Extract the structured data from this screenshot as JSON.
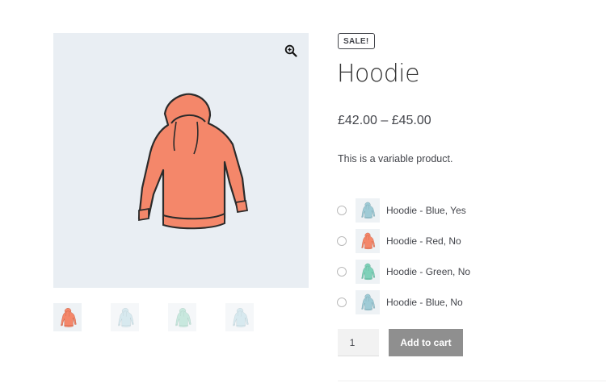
{
  "product": {
    "sale_badge": "SALE!",
    "title": "Hoodie",
    "price": "£42.00 – £45.00",
    "description": "This is a variable product."
  },
  "gallery": {
    "main_color": "#f4876a",
    "thumbs": [
      {
        "color": "#f4876a",
        "faded": false
      },
      {
        "color": "#b8d8e3",
        "faded": true
      },
      {
        "color": "#9cd6c4",
        "faded": true
      },
      {
        "color": "#b8d8e3",
        "faded": true
      }
    ]
  },
  "variations": [
    {
      "label": "Hoodie - Blue, Yes",
      "color": "#9fcbd6"
    },
    {
      "label": "Hoodie - Red, No",
      "color": "#f4876a"
    },
    {
      "label": "Hoodie - Green, No",
      "color": "#7fd1b9"
    },
    {
      "label": "Hoodie - Blue, No",
      "color": "#9fcbd6"
    }
  ],
  "cart": {
    "quantity": "1",
    "add_to_cart_label": "Add to cart"
  },
  "colors": {
    "button_bg": "#8f8f8f",
    "text": "#43454b",
    "image_bg": "#e9eef3"
  }
}
